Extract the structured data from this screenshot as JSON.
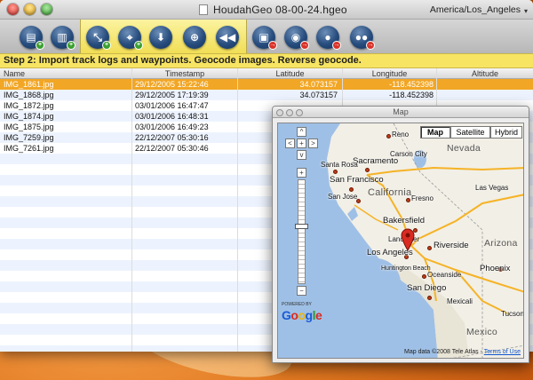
{
  "window": {
    "title": "HoudahGeo 08-00-24.hgeo",
    "timezone": "America/Los_Angeles"
  },
  "toolbar": {
    "buttons": [
      {
        "icon": "load-images-icon"
      },
      {
        "icon": "import-folder-icon"
      },
      {
        "icon": "import-track-log-icon"
      },
      {
        "icon": "geocode-from-gps-icon"
      },
      {
        "icon": "place-pin-icon"
      },
      {
        "icon": "reverse-geocode-icon"
      },
      {
        "icon": "rewind-icon"
      },
      {
        "icon": "export-exif-icon"
      },
      {
        "icon": "export-google-earth-icon"
      },
      {
        "icon": "export-flickr-icon"
      },
      {
        "icon": "export-locr-icon"
      }
    ]
  },
  "step": {
    "text": "Step 2: Import track logs and waypoints. Geocode images. Reverse geocode."
  },
  "table": {
    "columns": [
      "Name",
      "Timestamp",
      "Latitude",
      "Longitude",
      "Altitude"
    ],
    "rows": [
      {
        "name": "IMG_1861.jpg",
        "timestamp": "29/12/2005 15:22:46",
        "latitude": "34.073157",
        "longitude": "-118.452398",
        "selected": true
      },
      {
        "name": "IMG_1868.jpg",
        "timestamp": "29/12/2005 17:19:39",
        "latitude": "34.073157",
        "longitude": "-118.452398",
        "selected": false
      },
      {
        "name": "IMG_1872.jpg",
        "timestamp": "03/01/2006 16:47:47",
        "latitude": "",
        "longitude": "",
        "selected": false
      },
      {
        "name": "IMG_1874.jpg",
        "timestamp": "03/01/2006 16:48:31",
        "latitude": "",
        "longitude": "",
        "selected": false
      },
      {
        "name": "IMG_1875.jpg",
        "timestamp": "03/01/2006 16:49:23",
        "latitude": "",
        "longitude": "",
        "selected": false
      },
      {
        "name": "IMG_7259.jpg",
        "timestamp": "22/12/2007 05:30:16",
        "latitude": "",
        "longitude": "",
        "selected": false
      },
      {
        "name": "IMG_7261.jpg",
        "timestamp": "22/12/2007 05:30:46",
        "latitude": "",
        "longitude": "",
        "selected": false
      }
    ]
  },
  "map": {
    "title": "Map",
    "types": [
      "Map",
      "Satellite",
      "Hybrid"
    ],
    "active_type": "Map",
    "pan_labels": {
      "up": "^",
      "left": "<",
      "center": "+",
      "right": ">",
      "down": "v"
    },
    "zoom_in": "+",
    "zoom_out": "−",
    "zoom_level_fraction": 0.55,
    "places": {
      "reno": "Reno",
      "carson_city": "Carson City",
      "sacramento": "Sacramento",
      "santa_rosa": "Santa Rosa",
      "san_francisco": "San Francisco",
      "san_jose": "San Jose",
      "fresno": "Fresno",
      "bakersfield": "Bakersfield",
      "lancaster": "Lancaster",
      "los_angeles": "Los Angeles",
      "riverside": "Riverside",
      "huntington_beach": "Huntington Beach",
      "oceanside": "Oceanside",
      "san_diego": "San Diego",
      "mexicali": "Mexicali",
      "phoenix": "Phoenix",
      "tucson": "Tucson",
      "las_vegas": "Las Vegas",
      "nevada": "Nevada",
      "california": "California",
      "arizona": "Arizona",
      "mexico": "Mexico"
    },
    "powered_by": "POWERED BY",
    "logo": "Google",
    "credit": "Map data ©2008 Tele Atlas -",
    "terms": "Terms of Use",
    "colors": {
      "land": "#f2efe6",
      "water": "#9fc0e6",
      "marker": "#d92b21",
      "highway": "#f5b326"
    }
  }
}
